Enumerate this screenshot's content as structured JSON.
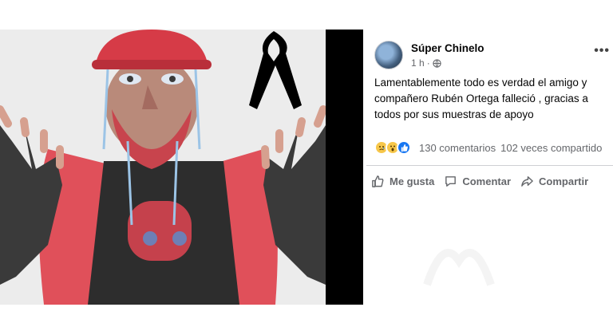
{
  "post": {
    "author": "Súper Chinelo",
    "time": "1 h",
    "separator": "·",
    "more_label": "•••",
    "text": "Lamentablemente todo es verdad el amigo y compañero Rubén Ortega falleció , gracias a todos por sus muestras de apoyo",
    "image_desc_icon": "mourning-ribbon-icon"
  },
  "reactions": {
    "types": [
      "sad",
      "wow",
      "like"
    ],
    "comments": "130 comentarios",
    "shares": "102 veces compartido"
  },
  "actions": {
    "like": "Me gusta",
    "comment": "Comentar",
    "share": "Compartir"
  },
  "colors": {
    "secondary_text": "#65676b",
    "like_blue": "#1877f2",
    "ribbon": "#000000",
    "cap_red": "#d63b47",
    "fur_red": "#e0505a"
  }
}
